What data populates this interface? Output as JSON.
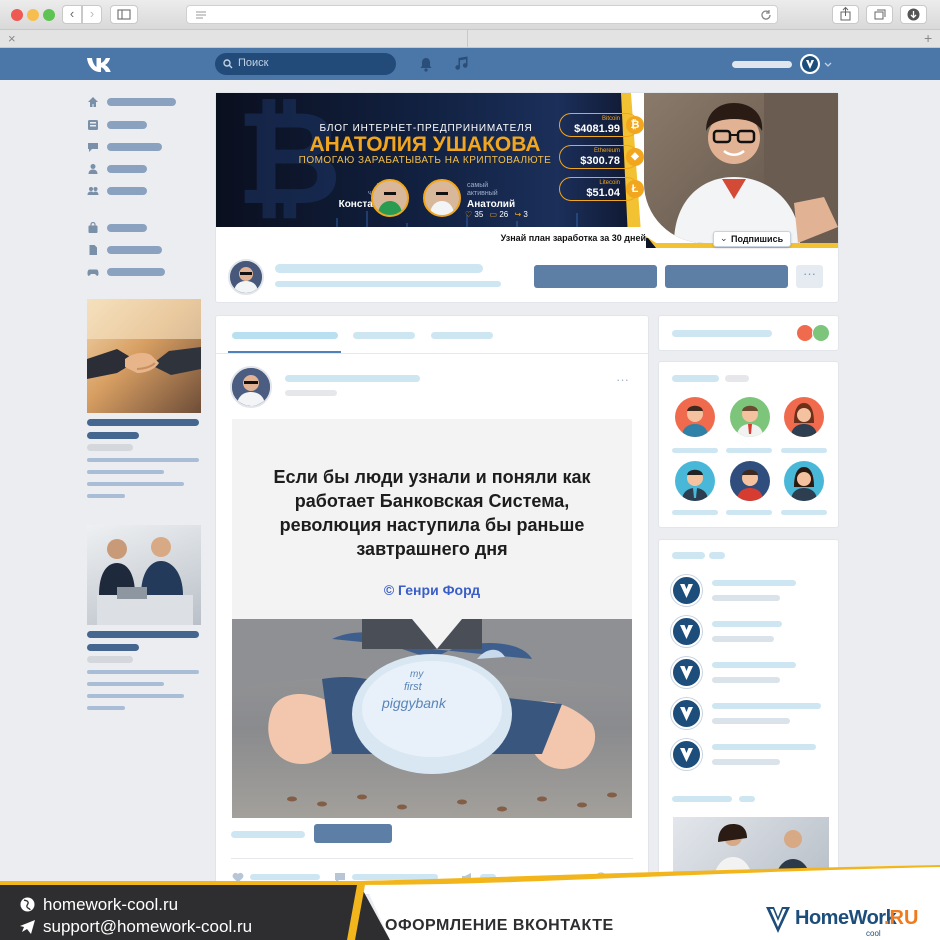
{
  "browser": {
    "titlebar_colors": {
      "close": "#ee5a52",
      "minimize": "#f6be4f",
      "zoom": "#5fc353"
    },
    "tab_close": "×",
    "new_tab": "+"
  },
  "vk_header": {
    "logo": "VK",
    "search_placeholder": "Поиск",
    "accent": "#4a76a8"
  },
  "cover": {
    "blog_line": "БЛОГ ИНТЕРНЕТ-ПРЕДПРИНИМАТЕЛЯ",
    "name": "АНАТОЛИЯ УШАКОВА",
    "subtitle": "ПОМОГАЮ ЗАРАБАТЫВАТЬ НА КРИПТОВАЛЮТЕ",
    "new_reader_label": "новый\nчитатель",
    "new_reader_name": "Константин",
    "active_label": "самый\nактивный",
    "active_name": "Анатолий",
    "active_stats": {
      "likes": "35",
      "comments": "26",
      "reposts": "3"
    },
    "crypto": [
      {
        "name": "Bitcoin",
        "price": "$4081.99"
      },
      {
        "name": "Ethereum",
        "price": "$300.78"
      },
      {
        "name": "Litecoin",
        "price": "$51.04"
      }
    ],
    "plan_text": "Узнай план заработка за 30 дней",
    "subscribe_label": "Подпишись"
  },
  "post": {
    "quote": "Если бы люди узнали и поняли как работает Банковская Система, революция наступила бы раньше завтрашнего дня",
    "author": "© Генри Форд",
    "image_caption_lines": [
      "my",
      "first",
      "piggybank"
    ]
  },
  "footer": {
    "site": "homework-cool.ru",
    "email": "support@homework-cool.ru",
    "title": "ОФОРМЛЕНИЕ ВКОНТАКТЕ",
    "logo_main": "HomeWork",
    "logo_suffix": ".RU",
    "logo_sub": "cool"
  }
}
